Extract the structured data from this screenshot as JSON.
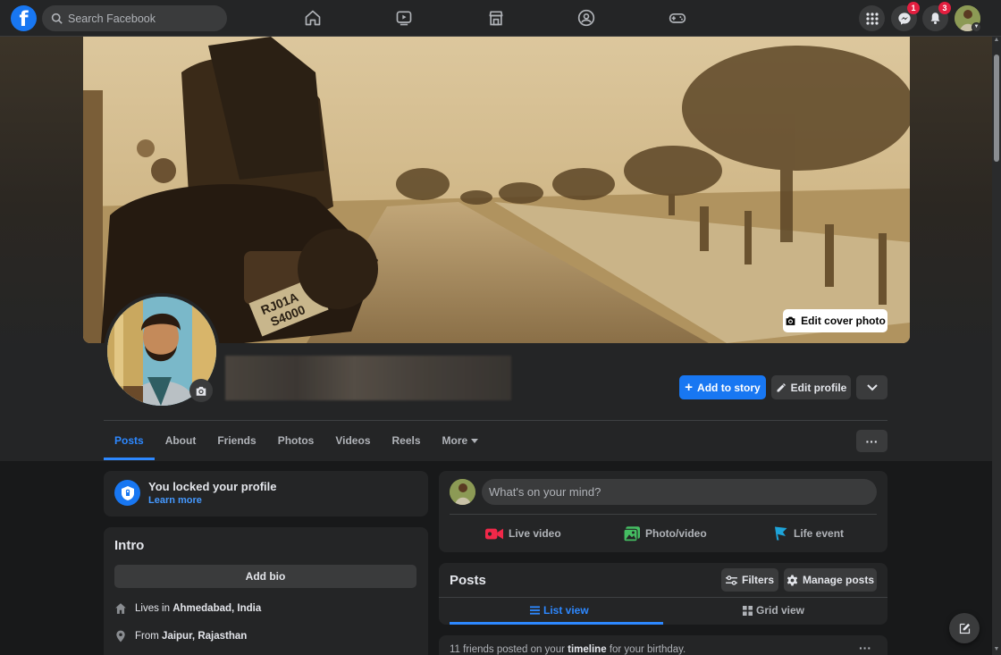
{
  "topbar": {
    "search_placeholder": "Search Facebook",
    "nav_icons": [
      "home-icon",
      "watch-icon",
      "marketplace-icon",
      "groups-icon",
      "gaming-icon"
    ],
    "messenger_badge": "1",
    "notifications_badge": "3"
  },
  "cover": {
    "edit_cover_label": "Edit cover photo"
  },
  "profile": {
    "add_story_label": "Add to story",
    "edit_profile_label": "Edit profile"
  },
  "tabs": {
    "items": [
      "Posts",
      "About",
      "Friends",
      "Photos",
      "Videos",
      "Reels"
    ],
    "more_label": "More",
    "active": "Posts"
  },
  "lock_card": {
    "title": "You locked your profile",
    "link": "Learn more"
  },
  "intro": {
    "title": "Intro",
    "add_bio_label": "Add bio",
    "lives_prefix": "Lives in",
    "lives_value": "Ahmedabad, India",
    "from_prefix": "From",
    "from_value": "Jaipur, Rajasthan"
  },
  "composer": {
    "placeholder": "What's on your mind?",
    "actions": [
      "Live video",
      "Photo/video",
      "Life event"
    ]
  },
  "posts": {
    "title": "Posts",
    "filters_label": "Filters",
    "manage_label": "Manage posts",
    "list_view_label": "List view",
    "grid_view_label": "Grid view",
    "birthday_prefix": "11 friends posted on your",
    "birthday_bold": "timeline",
    "birthday_suffix": "for your birthday."
  },
  "colors": {
    "accent": "#1877f2",
    "link": "#2d88ff",
    "background": "#18191a",
    "card": "#242526",
    "badge": "#e41e3f"
  }
}
